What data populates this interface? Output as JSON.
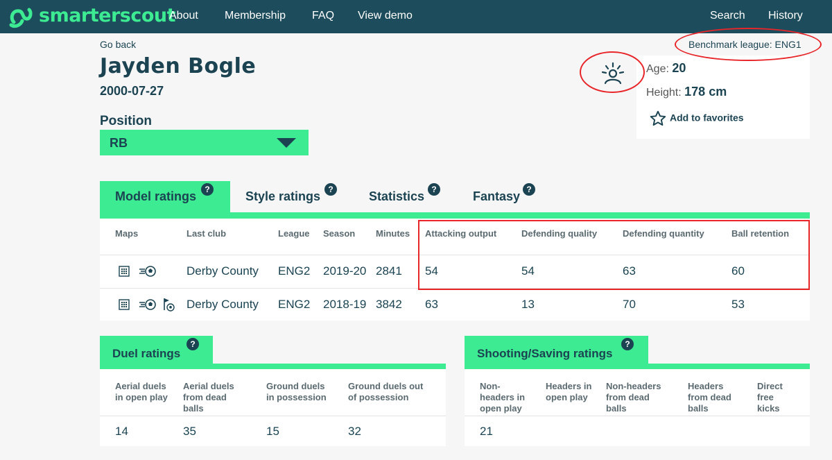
{
  "nav": {
    "brand": "smarterscout",
    "links": [
      "About",
      "Membership",
      "FAQ",
      "View demo"
    ],
    "right_links": [
      "Search",
      "History"
    ]
  },
  "header": {
    "go_back": "Go back",
    "player_name": "Jayden Bogle",
    "dob": "2000-07-27",
    "position_label": "Position",
    "position_value": "RB",
    "benchmark": "Benchmark league: ENG1"
  },
  "info": {
    "age_label": "Age:",
    "age_value": "20",
    "height_label": "Height:",
    "height_value": "178 cm",
    "favorites": "Add to favorites"
  },
  "tabs": [
    {
      "label": "Model ratings",
      "active": true
    },
    {
      "label": "Style ratings",
      "active": false
    },
    {
      "label": "Statistics",
      "active": false
    },
    {
      "label": "Fantasy",
      "active": false
    }
  ],
  "model_table": {
    "headers": [
      "Maps",
      "Last club",
      "League",
      "Season",
      "Minutes",
      "Attacking output",
      "Defending quality",
      "Defending quantity",
      "Ball retention"
    ],
    "rows": [
      {
        "club": "Derby County",
        "league": "ENG2",
        "season": "2019-20",
        "minutes": "2841",
        "attacking": "54",
        "def_quality": "54",
        "def_quantity": "63",
        "retention": "60"
      },
      {
        "club": "Derby County",
        "league": "ENG2",
        "season": "2018-19",
        "minutes": "3842",
        "attacking": "63",
        "def_quality": "13",
        "def_quantity": "70",
        "retention": "53"
      }
    ]
  },
  "duel": {
    "title": "Duel ratings",
    "headers": [
      "Aerial duels\nin open play",
      "Aerial duels\nfrom dead\nballs",
      "Ground duels\nin possession",
      "Ground duels out\nof possession"
    ],
    "values": [
      "14",
      "35",
      "15",
      "32"
    ]
  },
  "shooting": {
    "title": "Shooting/Saving ratings",
    "headers": [
      "Non-\nheaders in\nopen play",
      "Headers in\nopen play",
      "Non-headers\nfrom dead\nballs",
      "Headers\nfrom dead\nballs",
      "Direct\nfree\nkicks"
    ],
    "values": [
      "21",
      "",
      "",
      "",
      ""
    ]
  },
  "colors": {
    "nav_bg": "#1d4c5c",
    "accent_green": "#3ceb92",
    "text_dark": "#1b4352",
    "annotation_red": "#e8262a"
  }
}
